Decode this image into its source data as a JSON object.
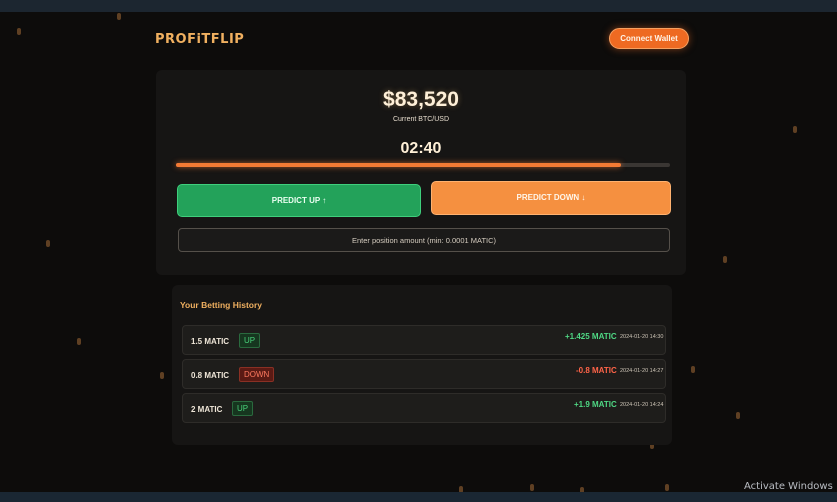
{
  "header": {
    "logo": "PROFiTFLIP",
    "connect_label": "Connect Wallet"
  },
  "market": {
    "price": "$83,520",
    "price_label": "Current BTC/USD",
    "timer": "02:40",
    "round_progress": 0.9
  },
  "actions": {
    "up_label": "PREDICT UP ↑",
    "down_label": "PREDICT DOWN ↓"
  },
  "amount": {
    "placeholder": "Enter position amount (min: 0.0001 MATIC)"
  },
  "history": {
    "title": "Your Betting History",
    "rows": [
      {
        "amount": "1.5 MATIC",
        "direction": "UP",
        "profit": "+1.425 MATIC",
        "time": "2024-01-20 14:30"
      },
      {
        "amount": "0.8 MATIC",
        "direction": "DOWN",
        "profit": "-0.8 MATIC",
        "time": "2024-01-20 14:27"
      },
      {
        "amount": "2 MATIC",
        "direction": "UP",
        "profit": "+1.9 MATIC",
        "time": "2024-01-20 14:24"
      }
    ]
  },
  "system": {
    "watermark": "Activate Windows"
  },
  "colors": {
    "background": "#0d0c0b",
    "accent_orange": "#f47a34",
    "up_green": "#23a25a",
    "down_orange": "#f59040",
    "loss_red": "#ff6448"
  }
}
